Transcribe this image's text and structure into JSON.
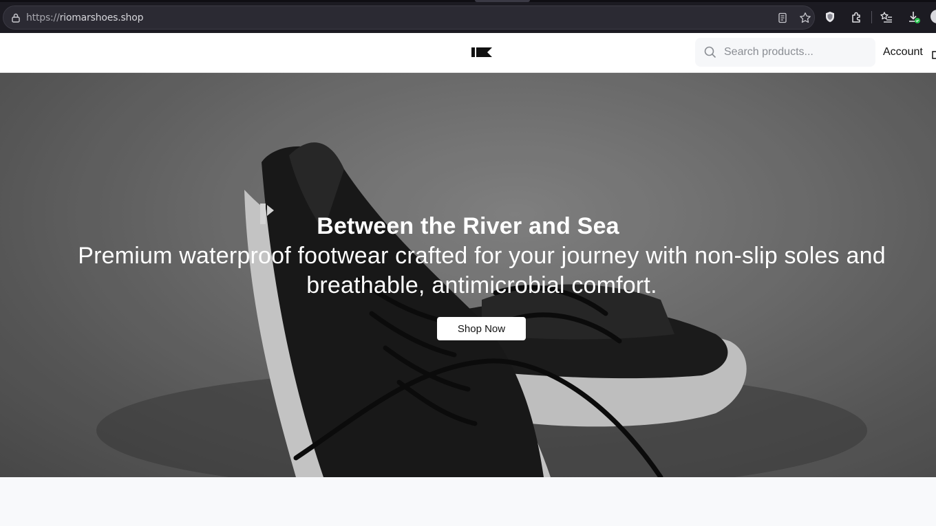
{
  "browser": {
    "url_protocol": "https://",
    "url_host": "riomarshoes.shop"
  },
  "header": {
    "search_placeholder": "Search products...",
    "account_label": "Account"
  },
  "hero": {
    "title": "Between the River and Sea",
    "subtitle": "Premium waterproof footwear crafted for your journey with non-slip soles and breathable, antimicrobial comfort.",
    "cta_label": "Shop Now"
  },
  "colors": {
    "browser_bg": "#1c1b22",
    "urlbar_bg": "#2b2a33",
    "header_bg": "#ffffff",
    "hero_text": "#ffffff",
    "cta_bg": "#ffffff"
  },
  "icons": [
    "lock-icon",
    "reader-view-icon",
    "bookmark-star-icon",
    "shield-icon",
    "extensions-icon",
    "bookmarks-list-icon",
    "downloads-icon",
    "profile-avatar",
    "site-logo",
    "search-icon",
    "cart-icon"
  ]
}
